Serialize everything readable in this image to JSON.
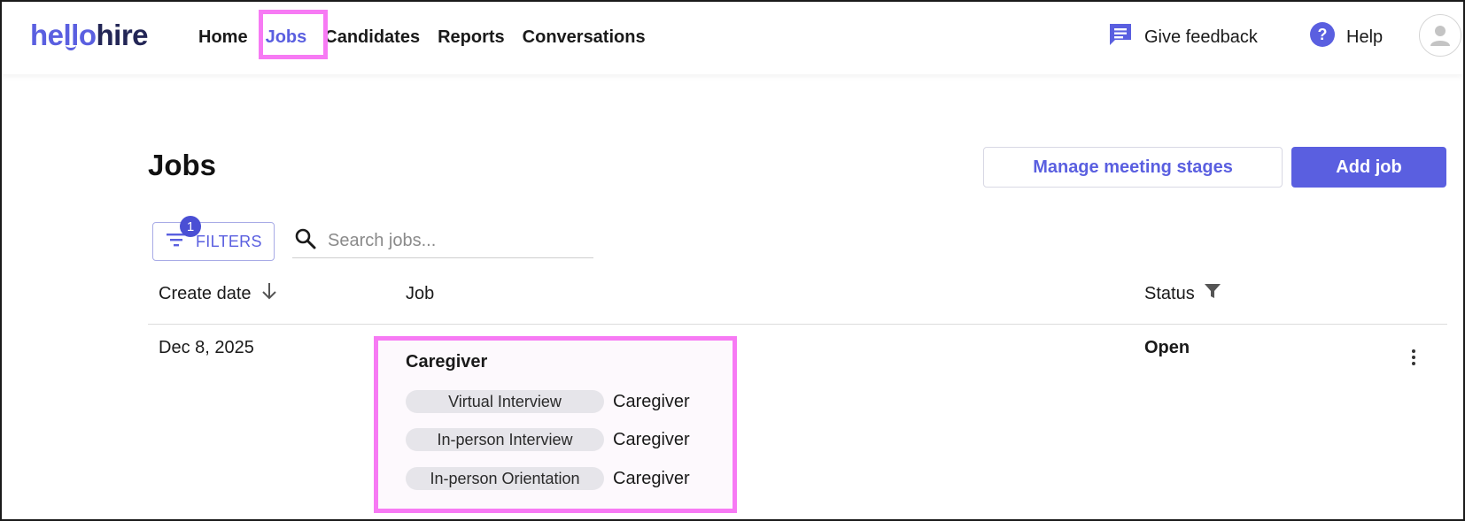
{
  "brand": {
    "hello": "hello",
    "hire": "hire",
    "accent": "#5a5fe0"
  },
  "nav": {
    "items": [
      {
        "label": "Home",
        "active": false
      },
      {
        "label": "Jobs",
        "active": true
      },
      {
        "label": "Candidates",
        "active": false
      },
      {
        "label": "Reports",
        "active": false
      },
      {
        "label": "Conversations",
        "active": false
      }
    ],
    "feedback_label": "Give feedback",
    "help_label": "Help"
  },
  "page": {
    "title": "Jobs",
    "manage_button": "Manage meeting stages",
    "add_button": "Add job"
  },
  "toolbar": {
    "filters_label": "FILTERS",
    "filters_count": "1",
    "search_placeholder": "Search jobs..."
  },
  "table": {
    "columns": {
      "create_date": "Create date",
      "job": "Job",
      "status": "Status"
    },
    "rows": [
      {
        "create_date": "Dec 8, 2025",
        "job_title": "Caregiver",
        "stages": [
          {
            "stage": "Virtual Interview",
            "role": "Caregiver"
          },
          {
            "stage": "In-person Interview",
            "role": "Caregiver"
          },
          {
            "stage": "In-person Orientation",
            "role": "Caregiver"
          }
        ],
        "status": "Open"
      }
    ]
  },
  "highlight_color": "#f77af4"
}
